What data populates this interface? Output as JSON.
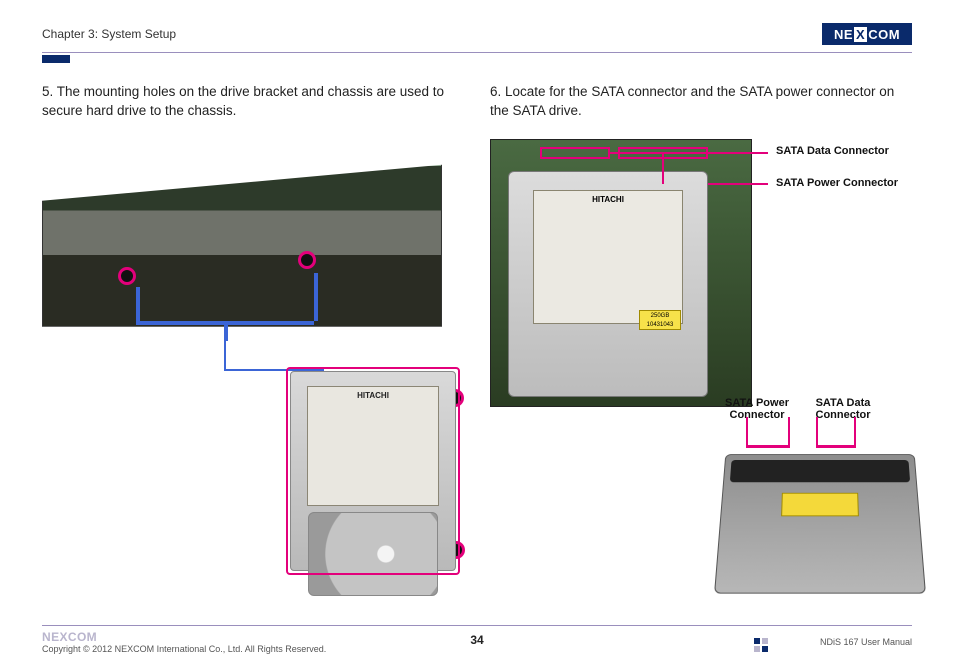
{
  "header": {
    "chapter": "Chapter 3: System Setup",
    "logo_text": "NEXCOM"
  },
  "left": {
    "step_text": "5.  The mounting holes on the drive bracket and chassis are used to secure hard drive to the chassis.",
    "hdd_brand": "HITACHI"
  },
  "right": {
    "step_text": "6.  Locate for the SATA connector and the SATA power connector on the SATA drive.",
    "hdd_brand": "HITACHI",
    "sticker_line1": "250GB",
    "sticker_line2": "10431043",
    "callout_data": "SATA Data Connector",
    "callout_power": "SATA Power Connector",
    "callout_power2": "SATA Power Connector",
    "callout_data2": "SATA Data Connector"
  },
  "footer": {
    "logo_text": "NEXCOM",
    "copyright": "Copyright © 2012 NEXCOM International Co., Ltd. All Rights Reserved.",
    "page_number": "34",
    "manual": "NDiS 167 User Manual"
  }
}
